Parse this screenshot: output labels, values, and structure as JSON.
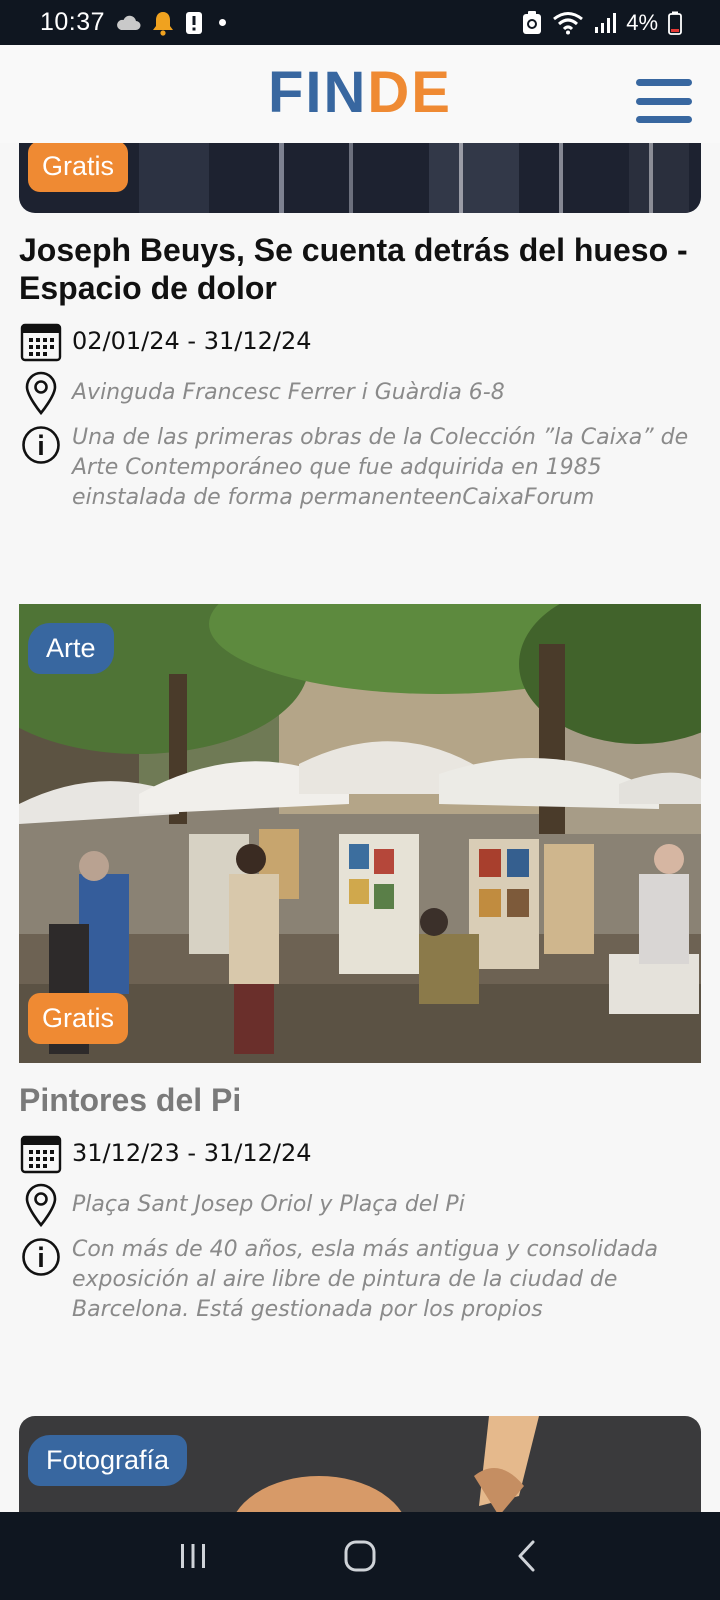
{
  "status_bar": {
    "time": "10:37",
    "battery": "4%",
    "icons": [
      "cloud-icon",
      "bell-icon",
      "alert-icon",
      "dot-icon",
      "recycle-icon",
      "wifi-icon",
      "signal-icon",
      "battery-icon"
    ]
  },
  "header": {
    "logo_part1": "FIN",
    "logo_part2": "DE",
    "menu_icon": "hamburger-icon"
  },
  "colors": {
    "brand_blue": "#3867a0",
    "brand_orange": "#ef8a33",
    "system_bar": "#0f1620"
  },
  "cards": [
    {
      "badges": [
        "Gratis"
      ],
      "title": "Joseph Beuys, Se cuenta detrás del hueso - Espacio de dolor",
      "date": "02/01/24 - 31/12/24",
      "location": "Avinguda Francesc Ferrer i Guàrdia 6-8",
      "description": "Una de las primeras obras de la Colección ”la Caixa” de Arte Contemporáneo que fue adquirida en 1985 einstalada de forma permanenteenCaixaForum"
    },
    {
      "badges": [
        "Arte",
        "Gratis"
      ],
      "title": "Pintores del Pi",
      "date": "31/12/23 - 31/12/24",
      "location": "Plaça Sant Josep Oriol y Plaça del Pi",
      "description": "Con más de 40 años, esla más antigua y consolidada exposición al aire libre de pintura de la ciudad de Barcelona. Está gestionada por los propios"
    },
    {
      "badges": [
        "Fotografía"
      ]
    }
  ],
  "nav_bar": {
    "icons": [
      "recent-apps-icon",
      "home-icon",
      "back-icon"
    ]
  }
}
